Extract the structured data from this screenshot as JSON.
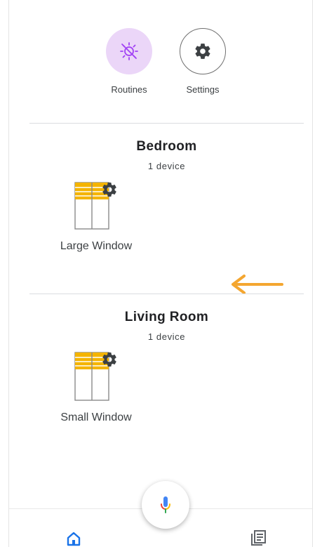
{
  "quick_actions": {
    "routines": {
      "label": "Routines",
      "icon": "routines-icon"
    },
    "settings": {
      "label": "Settings",
      "icon": "gear-icon"
    }
  },
  "rooms": [
    {
      "name": "Bedroom",
      "subtitle": "1 device",
      "devices": [
        {
          "label": "Large Window",
          "icon": "window-blind-icon"
        }
      ]
    },
    {
      "name": "Living Room",
      "subtitle": "1 device",
      "devices": [
        {
          "label": "Small Window",
          "icon": "window-blind-icon"
        }
      ]
    }
  ],
  "bottom_nav": {
    "home_icon": "home-icon",
    "mic_icon": "microphone-icon",
    "feed_icon": "feed-icon"
  },
  "colors": {
    "routines_bg": "#ebd6f8",
    "routines_icon": "#a142f4",
    "blind_yellow": "#f4b400",
    "annotation_arrow": "#f4a630",
    "home_active": "#1a73e8"
  }
}
